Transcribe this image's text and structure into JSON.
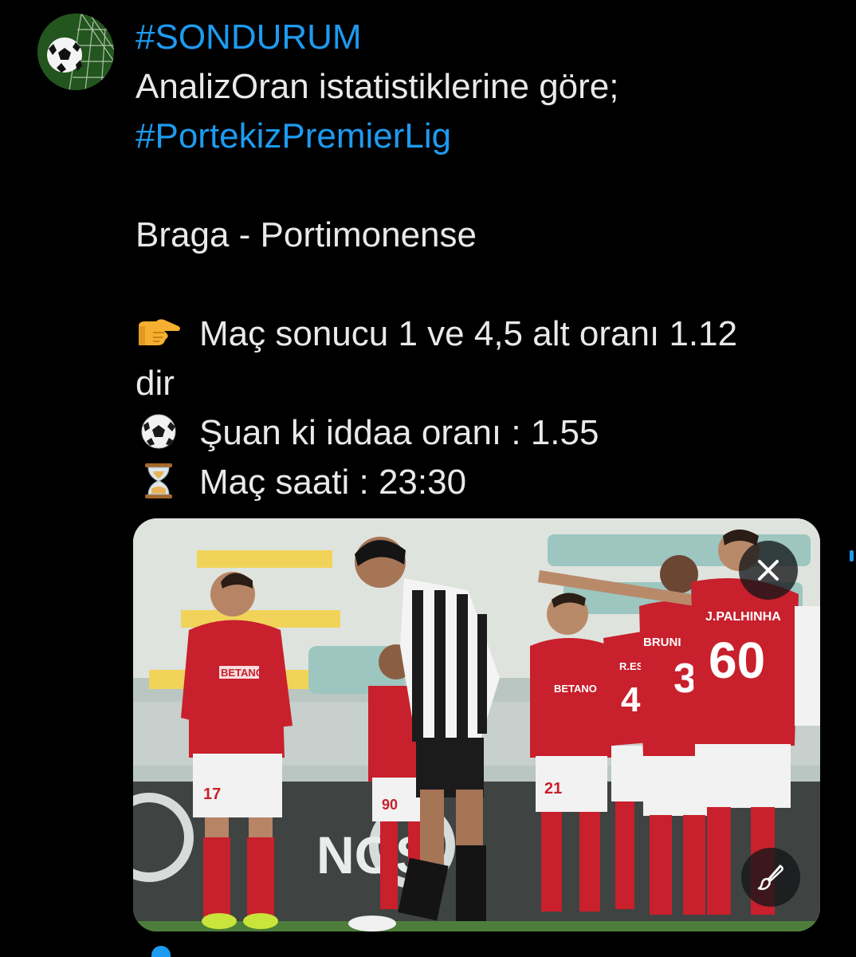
{
  "tweet": {
    "hashtag_top": "#SONDURUM",
    "intro": "AnalizOran istatistiklerine göre;",
    "hashtag_league": "#PortekizPremierLig",
    "match": "Braga - Portimonense",
    "line_result": "Maç sonucu 1 ve 4,5 alt oranı 1.12",
    "line_result_cont": "dir",
    "line_odds": "Şuan ki iddaa oranı : 1.55",
    "line_time": "Maç saati : 23:30"
  },
  "icons": {
    "avatar": "soccer-ball-net-avatar",
    "pointing": "backhand-index-pointing-right-icon",
    "ball": "soccer-ball-icon",
    "hourglass": "hourglass-icon",
    "close": "close-icon",
    "edit": "paintbrush-edit-icon"
  },
  "media": {
    "jersey_name": "J.PALHINHA",
    "jersey_number": "60",
    "jersey_number_2": "3",
    "jersey_name_2": "BRUNI",
    "jersey_number_3": "4",
    "jersey_name_3": "R.ES",
    "short_left": "17",
    "short_mid": "21",
    "short_mid2": "90",
    "sponsor": "BETANO",
    "board_text": "NOS"
  },
  "colors": {
    "background": "#000000",
    "text": "#e7e9ea",
    "link": "#1d9bf0",
    "braga_red": "#c8202c"
  }
}
